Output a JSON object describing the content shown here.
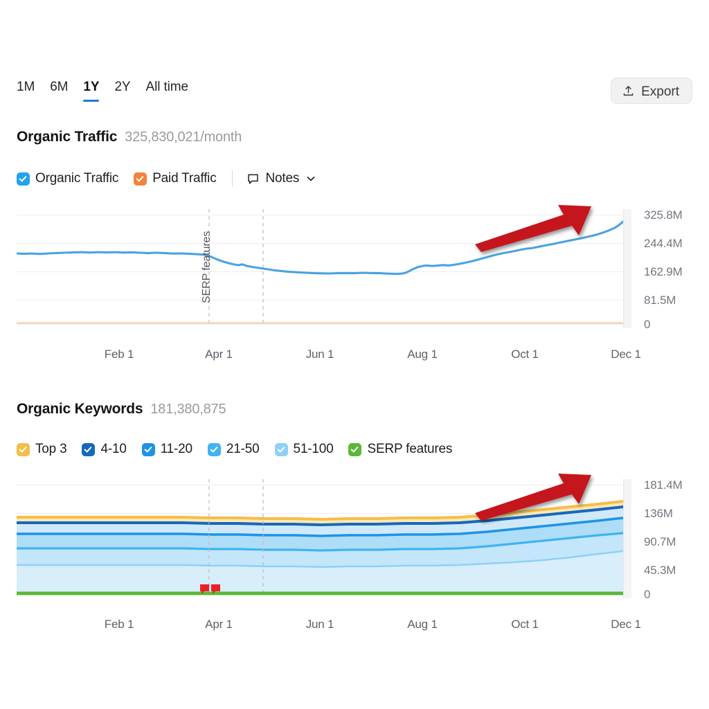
{
  "toolbar": {
    "ranges": [
      {
        "label": "1M",
        "active": false
      },
      {
        "label": "6M",
        "active": false
      },
      {
        "label": "1Y",
        "active": true
      },
      {
        "label": "2Y",
        "active": false
      },
      {
        "label": "All time",
        "active": false
      }
    ],
    "export_label": "Export",
    "export_icon": "upload-icon"
  },
  "traffic": {
    "title": "Organic Traffic",
    "value": "325,830,021/month",
    "legend": [
      {
        "label": "Organic Traffic",
        "color": "#22a3ee",
        "checked": true
      },
      {
        "label": "Paid Traffic",
        "color": "#f5813c",
        "checked": true
      }
    ],
    "notes_label": "Notes",
    "notes_icon": "speech-bubble-icon",
    "notes_chevron_icon": "chevron-down-icon",
    "annotation": "SERP features",
    "arrow_color": "#c4121f"
  },
  "keywords": {
    "title": "Organic Keywords",
    "value": "181,380,875",
    "legend": [
      {
        "label": "Top 3",
        "color": "#f5bd48",
        "checked": true
      },
      {
        "label": "4-10",
        "color": "#1668ba",
        "checked": true
      },
      {
        "label": "11-20",
        "color": "#1e93e6",
        "checked": true
      },
      {
        "label": "21-50",
        "color": "#3fb4f2",
        "checked": true
      },
      {
        "label": "51-100",
        "color": "#8fd0f6",
        "checked": true
      },
      {
        "label": "SERP features",
        "color": "#5cb739",
        "checked": true
      }
    ],
    "arrow_color": "#c4121f"
  },
  "chart_data": [
    {
      "type": "line",
      "title": "Organic Traffic",
      "subtitle": "325,830,021/month",
      "xlabel": "",
      "ylabel": "",
      "grid": true,
      "legend_position": "top",
      "ylim": [
        0,
        325800000
      ],
      "yticks": [
        0,
        81500000,
        162900000,
        244400000,
        325800000
      ],
      "ytick_labels": [
        "0",
        "81.5M",
        "162.9M",
        "244.4M",
        "325.8M"
      ],
      "xticks": [
        "Feb 1",
        "Apr 1",
        "Jun 1",
        "Aug 1",
        "Oct 1",
        "Dec 1"
      ],
      "annotations": [
        {
          "text": "SERP features",
          "at": "Apr 1",
          "orientation": "vertical"
        },
        {
          "text": "",
          "type": "arrow",
          "from": "Sep 1",
          "to": "Nov 15",
          "color": "#c4121f"
        }
      ],
      "series": [
        {
          "name": "Organic Traffic",
          "color": "#4aa3e0",
          "x": [
            "Jan 1",
            "Jan 15",
            "Feb 1",
            "Feb 15",
            "Mar 1",
            "Mar 15",
            "Apr 1",
            "Apr 15",
            "May 1",
            "May 15",
            "Jun 1",
            "Jun 15",
            "Jul 1",
            "Jul 15",
            "Aug 1",
            "Aug 15",
            "Sep 1",
            "Sep 15",
            "Oct 1",
            "Oct 15",
            "Nov 1",
            "Nov 15",
            "Dec 1",
            "Dec 15"
          ],
          "values": [
            203000000,
            202000000,
            204000000,
            206000000,
            203000000,
            193000000,
            180000000,
            175000000,
            172000000,
            169000000,
            170000000,
            172000000,
            174000000,
            176000000,
            190000000,
            186000000,
            198000000,
            215000000,
            232000000,
            248000000,
            262000000,
            278000000,
            295000000,
            318000000
          ]
        },
        {
          "name": "Paid Traffic",
          "color": "#f3ccb0",
          "x": [
            "Jan 1",
            "Mar 1",
            "Jun 1",
            "Sep 1",
            "Dec 15"
          ],
          "values": [
            0,
            0,
            0,
            0,
            0
          ]
        }
      ]
    },
    {
      "type": "area",
      "title": "Organic Keywords",
      "subtitle": "181,380,875",
      "stacked": true,
      "xlabel": "",
      "ylabel": "",
      "grid": true,
      "legend_position": "top",
      "ylim": [
        0,
        181400000
      ],
      "yticks": [
        0,
        45300000,
        90700000,
        136000000,
        181400000
      ],
      "ytick_labels": [
        "0",
        "45.3M",
        "90.7M",
        "136M",
        "181.4M"
      ],
      "xticks": [
        "Feb 1",
        "Apr 1",
        "Jun 1",
        "Aug 1",
        "Oct 1",
        "Dec 1"
      ],
      "annotations": [
        {
          "text": "",
          "type": "arrow",
          "from": "Sep 1",
          "to": "Nov 15",
          "color": "#c4121f"
        },
        {
          "text": "",
          "type": "note-marker",
          "at": "Apr 1",
          "color": "#ea2027"
        }
      ],
      "x": [
        "Jan 1",
        "Jan 15",
        "Feb 1",
        "Feb 15",
        "Mar 1",
        "Mar 15",
        "Apr 1",
        "Apr 15",
        "May 1",
        "May 15",
        "Jun 1",
        "Jun 15",
        "Jul 1",
        "Jul 15",
        "Aug 1",
        "Aug 15",
        "Sep 1",
        "Sep 15",
        "Oct 1",
        "Oct 15",
        "Nov 1",
        "Nov 15",
        "Dec 1",
        "Dec 15"
      ],
      "series": [
        {
          "name": "SERP features",
          "color": "#5cb739",
          "values": [
            1800000,
            1800000,
            1800000,
            1800000,
            1800000,
            1800000,
            1800000,
            1800000,
            1800000,
            1800000,
            1800000,
            1800000,
            1800000,
            1800000,
            1800000,
            1800000,
            1800000,
            1800000,
            1800000,
            1800000,
            1800000,
            1800000,
            1800000,
            1800000
          ]
        },
        {
          "name": "51-100",
          "color": "#cbe8fa",
          "values": [
            46000000,
            46000000,
            46500000,
            46500000,
            46000000,
            45500000,
            45500000,
            45500000,
            45000000,
            45000000,
            45500000,
            45500000,
            45500000,
            46000000,
            46500000,
            46500000,
            47000000,
            48000000,
            49000000,
            50000000,
            50500000,
            51000000,
            51500000,
            52000000
          ]
        },
        {
          "name": "21-50",
          "color": "#b4e0f8",
          "values": [
            33000000,
            33000000,
            33500000,
            33500000,
            33000000,
            32500000,
            32500000,
            32500000,
            32500000,
            32500000,
            33000000,
            33000000,
            33000000,
            33500000,
            34000000,
            34500000,
            35000000,
            37000000,
            39000000,
            41000000,
            42500000,
            44000000,
            45500000,
            47000000
          ]
        },
        {
          "name": "11-20",
          "color": "#9ed6f5",
          "values": [
            18000000,
            18000000,
            18200000,
            18200000,
            18000000,
            17800000,
            17800000,
            17800000,
            17800000,
            17800000,
            18000000,
            18000000,
            18000000,
            18200000,
            18500000,
            18800000,
            19000000,
            20000000,
            21500000,
            22500000,
            23500000,
            24500000,
            25500000,
            27000000
          ]
        },
        {
          "name": "4-10",
          "color": "#bfe3fa",
          "values": [
            8000000,
            8000000,
            8100000,
            8100000,
            8000000,
            7900000,
            7900000,
            7900000,
            7900000,
            7900000,
            8000000,
            8000000,
            8000000,
            8100000,
            8300000,
            8400000,
            8600000,
            9200000,
            9800000,
            10400000,
            10900000,
            11400000,
            11900000,
            12600000
          ]
        },
        {
          "name": "Top 3",
          "color": "#f5bd48",
          "values": [
            3200000,
            3200000,
            3250000,
            3250000,
            3200000,
            3150000,
            3150000,
            3150000,
            3150000,
            3150000,
            3200000,
            3200000,
            3200000,
            3250000,
            3350000,
            3400000,
            3500000,
            3800000,
            4100000,
            4400000,
            4700000,
            5000000,
            5300000,
            5700000
          ]
        }
      ]
    }
  ]
}
